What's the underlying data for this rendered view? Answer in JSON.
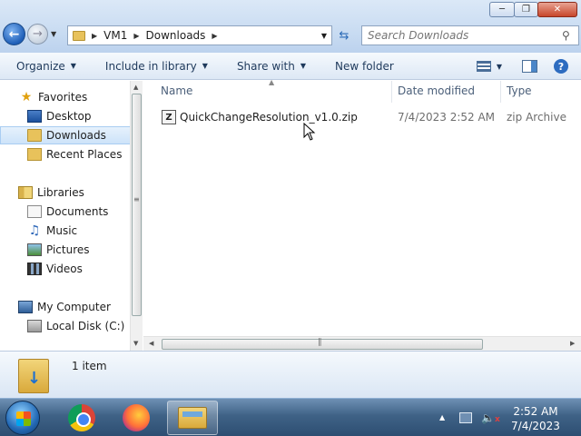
{
  "window": {
    "address": {
      "crumbs": [
        "VM1",
        "Downloads"
      ]
    },
    "search": {
      "placeholder": "Search Downloads"
    },
    "buttons": {
      "back": "back",
      "forward": "forward",
      "refresh": "refresh"
    }
  },
  "toolbar": {
    "organize": "Organize",
    "include_in_library": "Include in library",
    "share_with": "Share with",
    "new_folder": "New folder"
  },
  "sidebar": {
    "favorites": {
      "label": "Favorites",
      "items": [
        "Desktop",
        "Downloads",
        "Recent Places"
      ]
    },
    "libraries": {
      "label": "Libraries",
      "items": [
        "Documents",
        "Music",
        "Pictures",
        "Videos"
      ]
    },
    "computer": {
      "label": "My Computer",
      "items": [
        "Local Disk (C:)"
      ]
    },
    "selected": "Downloads"
  },
  "file_list": {
    "columns": [
      "Name",
      "Date modified",
      "Type"
    ],
    "rows": [
      {
        "name": "QuickChangeResolution_v1.0.zip",
        "date_modified": "7/4/2023 2:52 AM",
        "type": "zip Archive"
      }
    ]
  },
  "details": {
    "item_count": "1 item"
  },
  "taskbar": {
    "clock": {
      "time": "2:52 AM",
      "date": "7/4/2023"
    },
    "pinned": [
      "chrome-icon",
      "firefox-icon",
      "explorer-icon"
    ]
  },
  "colors": {
    "accent": "#2d6cc0",
    "selection": "#cde3f9",
    "taskbar": "#3f6286"
  }
}
